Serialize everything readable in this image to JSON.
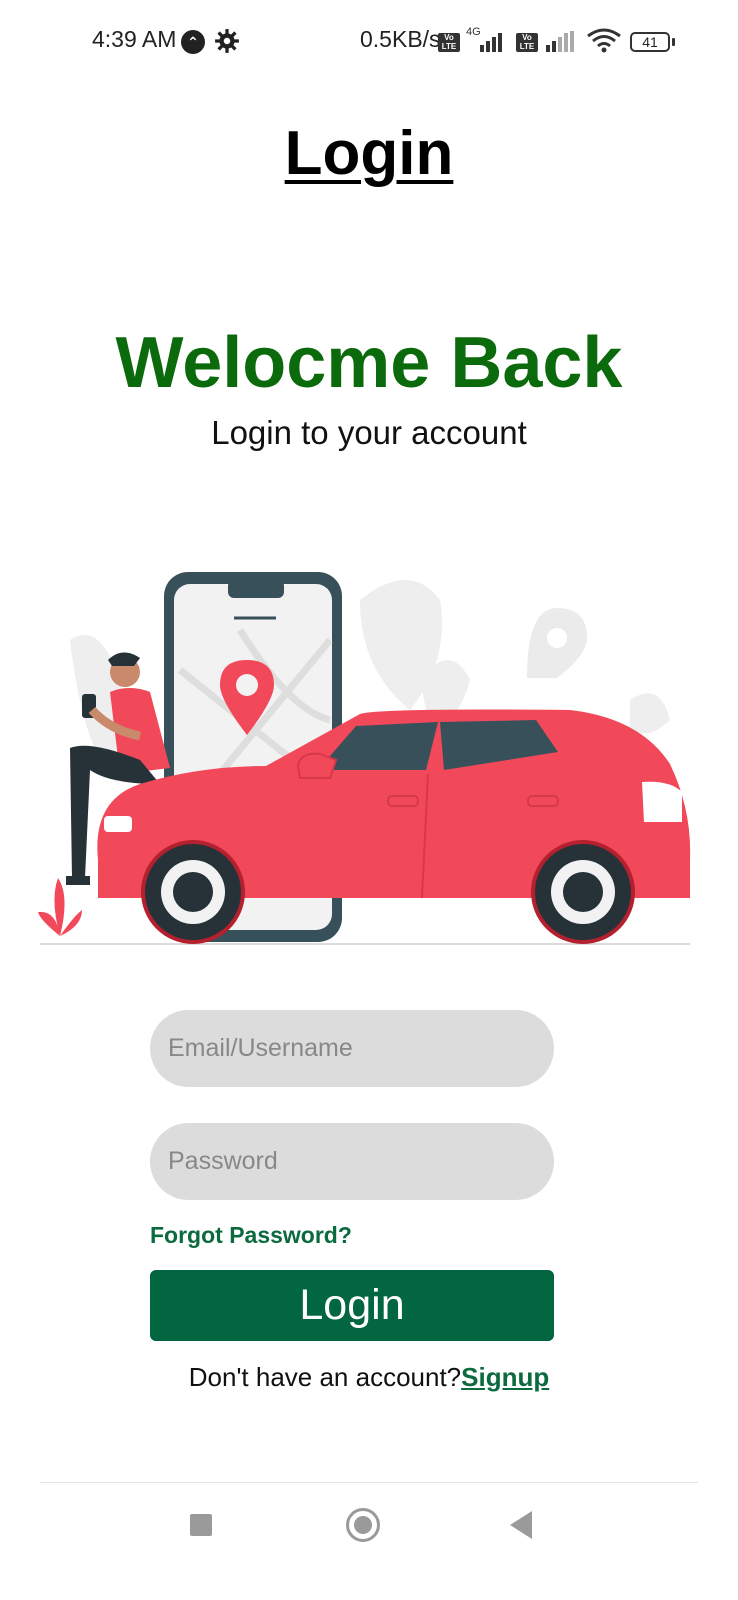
{
  "status_bar": {
    "time": "4:39 AM",
    "network_speed": "0.5KB/s",
    "network_type": "4G",
    "volte_label": "Vo LTE",
    "battery": "41",
    "icons": [
      "navigation-icon",
      "settings-gear-icon",
      "volte-icon",
      "signal-icon",
      "wifi-icon",
      "battery-icon"
    ]
  },
  "header": {
    "title": "Login"
  },
  "welcome": {
    "heading": "Welocme Back",
    "subheading": "Login to your account"
  },
  "form": {
    "email_placeholder": "Email/Username",
    "email_value": "",
    "password_placeholder": "Password",
    "password_value": "",
    "forgot_label": "Forgot Password?",
    "login_label": "Login",
    "signup_prompt": "Don't have an account?",
    "signup_link": "Signup"
  },
  "colors": {
    "accent_green": "#026741",
    "welcome_green": "#0b6a0b",
    "field_bg": "#dcdcdc",
    "car_red": "#f2495a"
  },
  "nav_bar": {
    "icons": [
      "recents-square-icon",
      "home-circle-icon",
      "back-triangle-icon"
    ]
  }
}
